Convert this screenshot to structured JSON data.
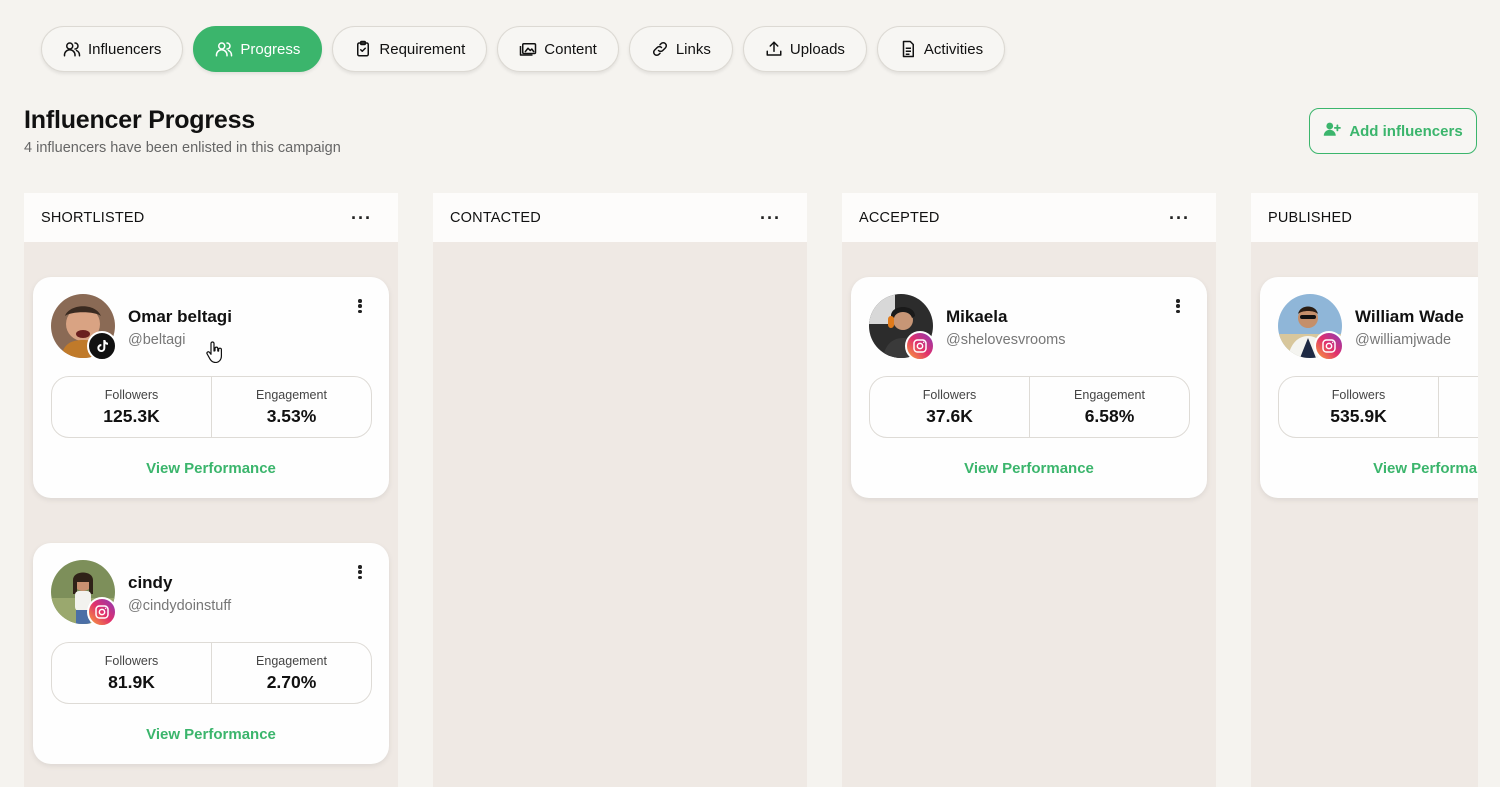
{
  "tabs": [
    {
      "label": "Influencers",
      "icon": "users-icon",
      "active": false
    },
    {
      "label": "Progress",
      "icon": "users-icon",
      "active": true
    },
    {
      "label": "Requirement",
      "icon": "clipboard-icon",
      "active": false
    },
    {
      "label": "Content",
      "icon": "images-icon",
      "active": false
    },
    {
      "label": "Links",
      "icon": "link-icon",
      "active": false
    },
    {
      "label": "Uploads",
      "icon": "upload-icon",
      "active": false
    },
    {
      "label": "Activities",
      "icon": "document-icon",
      "active": false
    }
  ],
  "header": {
    "title": "Influencer Progress",
    "subtitle": "4 influencers have been enlisted in this campaign",
    "add_button": "Add influencers"
  },
  "columns": [
    {
      "title": "SHORTLISTED",
      "menu": "···"
    },
    {
      "title": "CONTACTED",
      "menu": "···"
    },
    {
      "title": "ACCEPTED",
      "menu": "···"
    },
    {
      "title": "PUBLISHED",
      "menu": "···"
    }
  ],
  "stat_labels": {
    "followers": "Followers",
    "engagement": "Engagement"
  },
  "view_performance": "View Performance",
  "cards": {
    "omar": {
      "name": "Omar beltagi",
      "handle": "@beltagi",
      "platform": "tiktok",
      "followers": "125.3K",
      "engagement": "3.53%"
    },
    "cindy": {
      "name": "cindy",
      "handle": "@cindydoinstuff",
      "platform": "instagram",
      "followers": "81.9K",
      "engagement": "2.70%"
    },
    "mikaela": {
      "name": "Mikaela",
      "handle": "@shelovesvrooms",
      "platform": "instagram",
      "followers": "37.6K",
      "engagement": "6.58%"
    },
    "william": {
      "name": "William Wade",
      "handle": "@williamjwade",
      "platform": "instagram",
      "followers": "535.9K",
      "engagement": ""
    }
  },
  "colors": {
    "accent": "#3bb56c",
    "background": "#f5f3ef",
    "column": "#efe9e4"
  }
}
